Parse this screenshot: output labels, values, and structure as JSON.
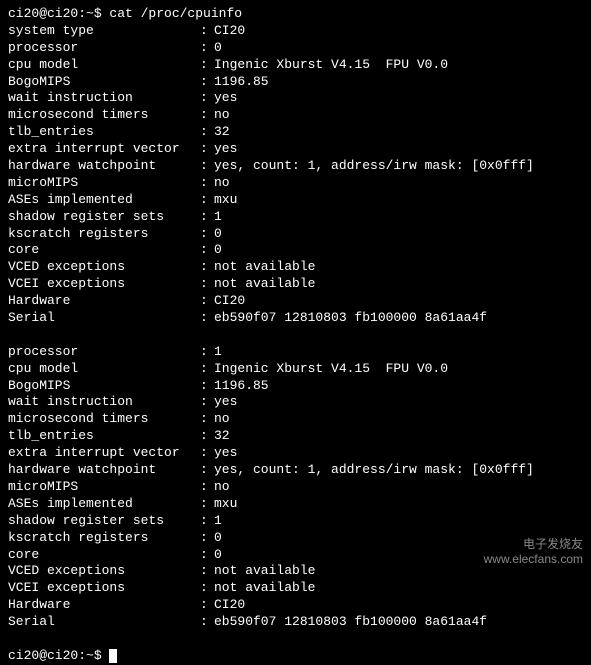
{
  "prompt1": "ci20@ci20:~$ ",
  "command": "cat /proc/cpuinfo",
  "rows": [
    {
      "k": "system type",
      "v": "CI20"
    },
    {
      "k": "processor",
      "v": "0"
    },
    {
      "k": "cpu model",
      "v": "Ingenic Xburst V4.15  FPU V0.0"
    },
    {
      "k": "BogoMIPS",
      "v": "1196.85"
    },
    {
      "k": "wait instruction",
      "v": "yes"
    },
    {
      "k": "microsecond timers",
      "v": "no"
    },
    {
      "k": "tlb_entries",
      "v": "32"
    },
    {
      "k": "extra interrupt vector",
      "v": "yes"
    },
    {
      "k": "hardware watchpoint",
      "v": "yes, count: 1, address/irw mask: [0x0fff]"
    },
    {
      "k": "microMIPS",
      "v": "no"
    },
    {
      "k": "ASEs implemented",
      "v": "mxu"
    },
    {
      "k": "shadow register sets",
      "v": "1"
    },
    {
      "k": "kscratch registers",
      "v": "0"
    },
    {
      "k": "core",
      "v": "0"
    },
    {
      "k": "VCED exceptions",
      "v": "not available"
    },
    {
      "k": "VCEI exceptions",
      "v": "not available"
    },
    {
      "k": "Hardware",
      "v": "CI20"
    },
    {
      "k": "Serial",
      "v": "eb590f07 12810803 fb100000 8a61aa4f"
    }
  ],
  "rows2": [
    {
      "k": "processor",
      "v": "1"
    },
    {
      "k": "cpu model",
      "v": "Ingenic Xburst V4.15  FPU V0.0"
    },
    {
      "k": "BogoMIPS",
      "v": "1196.85"
    },
    {
      "k": "wait instruction",
      "v": "yes"
    },
    {
      "k": "microsecond timers",
      "v": "no"
    },
    {
      "k": "tlb_entries",
      "v": "32"
    },
    {
      "k": "extra interrupt vector",
      "v": "yes"
    },
    {
      "k": "hardware watchpoint",
      "v": "yes, count: 1, address/irw mask: [0x0fff]"
    },
    {
      "k": "microMIPS",
      "v": "no"
    },
    {
      "k": "ASEs implemented",
      "v": "mxu"
    },
    {
      "k": "shadow register sets",
      "v": "1"
    },
    {
      "k": "kscratch registers",
      "v": "0"
    },
    {
      "k": "core",
      "v": "0"
    },
    {
      "k": "VCED exceptions",
      "v": "not available"
    },
    {
      "k": "VCEI exceptions",
      "v": "not available"
    },
    {
      "k": "Hardware",
      "v": "CI20"
    },
    {
      "k": "Serial",
      "v": "eb590f07 12810803 fb100000 8a61aa4f"
    }
  ],
  "prompt2": "ci20@ci20:~$ ",
  "watermark": "电子发烧友\nwww.elecfans.com"
}
